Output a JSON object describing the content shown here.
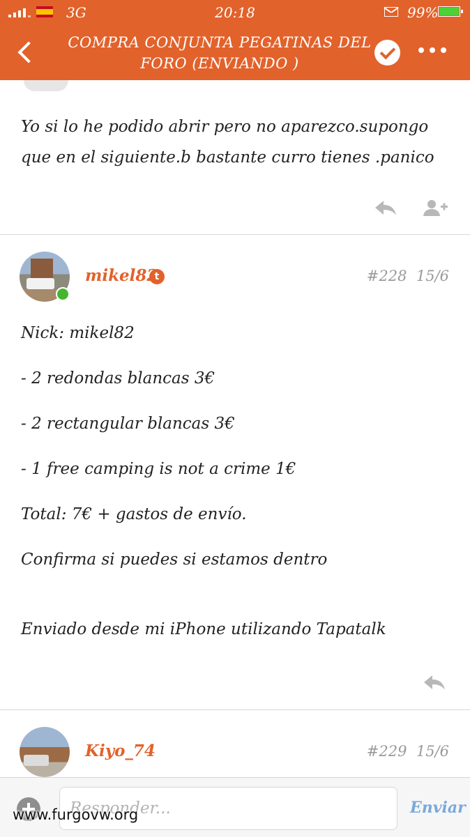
{
  "status_bar": {
    "carrier": "3G",
    "time": "20:18",
    "battery": "99%",
    "battery_level": 0.99
  },
  "header": {
    "title": "COMPRA CONJUNTA PEGATINAS DEL FORO (ENVIANDO )",
    "back_icon": "chevron-left-icon",
    "check_icon": "check-circle-icon",
    "more_icon": "more-dots-icon"
  },
  "posts": [
    {
      "text": "Yo si lo he podido  abrir pero no aparezco.supongo que en el siguiente.b bastante curro tienes  .panico",
      "actions": [
        "reply-icon",
        "follow-user-icon"
      ]
    },
    {
      "username": "mikel82",
      "badge": "t",
      "number": "#228",
      "date": "15/6",
      "lines": [
        "Nick: mikel82",
        "- 2 redondas blancas 3€",
        "- 2 rectangular blancas 3€",
        "- 1 free camping is not a crime 1€",
        "Total: 7€ + gastos de envío.",
        "Confirma si puedes si estamos dentro",
        "Enviado desde mi iPhone utilizando Tapatalk"
      ]
    },
    {
      "username": "Kiyo_74",
      "number": "#229",
      "date": "15/6"
    }
  ],
  "composer": {
    "placeholder": "Responder...",
    "send_label": "Enviar"
  },
  "watermark": "www.furgovw.org",
  "colors": {
    "accent": "#e2622b",
    "send": "#79a9dc",
    "online": "#44b52f"
  }
}
